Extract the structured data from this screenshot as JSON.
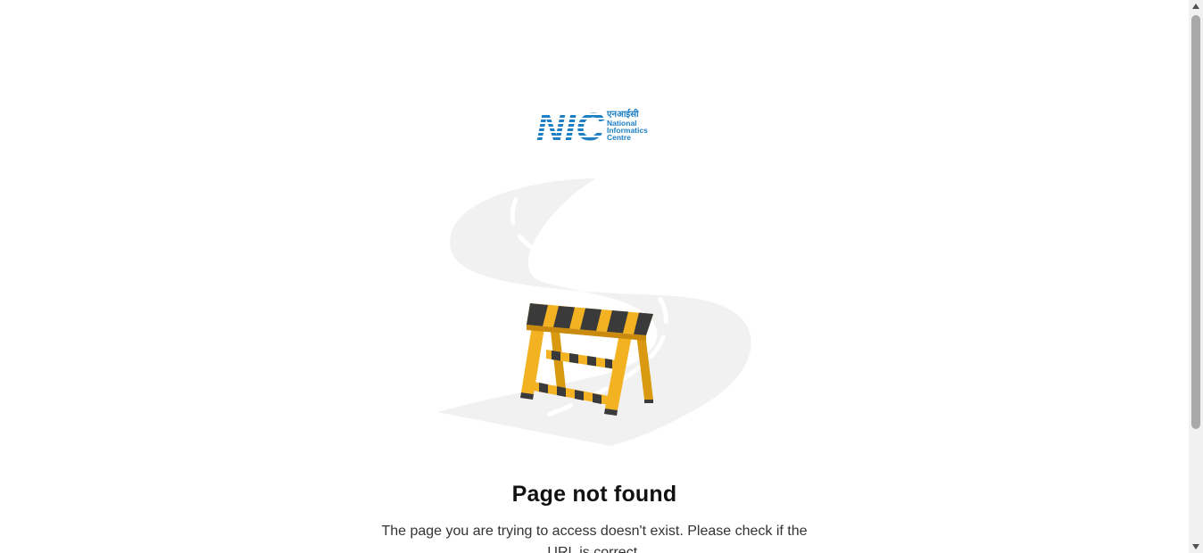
{
  "logo": {
    "mark": "NIC",
    "hindi": "एनआईसी",
    "line1": "National",
    "line2": "Informatics",
    "line3": "Centre"
  },
  "illustration": {
    "name": "road-barrier-illustration",
    "colors": {
      "road": "#f1f1f1",
      "barrier_yellow": "#f2b221",
      "barrier_dark": "#3a3a3a"
    }
  },
  "error": {
    "title": "Page not found",
    "message": "The page you are trying to access doesn't exist. Please check if the URL is correct."
  },
  "colors": {
    "brand_blue": "#1d7fc4",
    "title_text": "#111111",
    "body_text": "#333333"
  }
}
